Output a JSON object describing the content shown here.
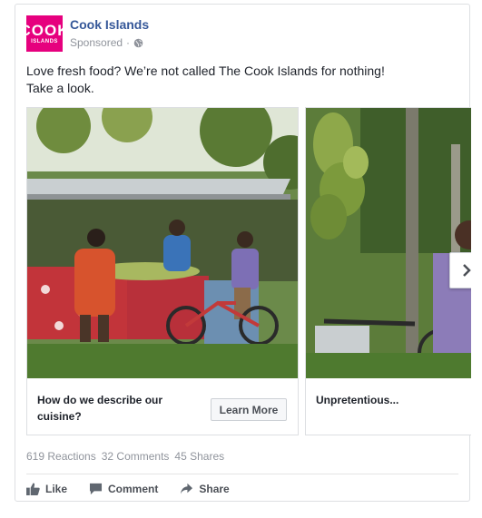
{
  "page": {
    "name": "Cook Islands",
    "logo_line1": "COOK",
    "logo_line2": "ISLANDS",
    "sponsored": "Sponsored",
    "separator": "·"
  },
  "post": {
    "text_line1": "Love fresh food? We’re not called The Cook Islands for nothing!",
    "text_line2": "Take a look."
  },
  "carousel": {
    "cards": [
      {
        "title": "How do we describe our cuisine?",
        "cta": "Learn More"
      },
      {
        "title": "Unpretentious..."
      }
    ],
    "next_icon": "chevron-right-icon"
  },
  "counts": {
    "reactions": "619 Reactions",
    "comments": "32 Comments",
    "shares": "45 Shares"
  },
  "actions": {
    "like": "Like",
    "comment": "Comment",
    "share": "Share"
  },
  "colors": {
    "brand_link": "#365899",
    "logo_bg": "#e6007e",
    "meta_gray": "#90949c"
  }
}
